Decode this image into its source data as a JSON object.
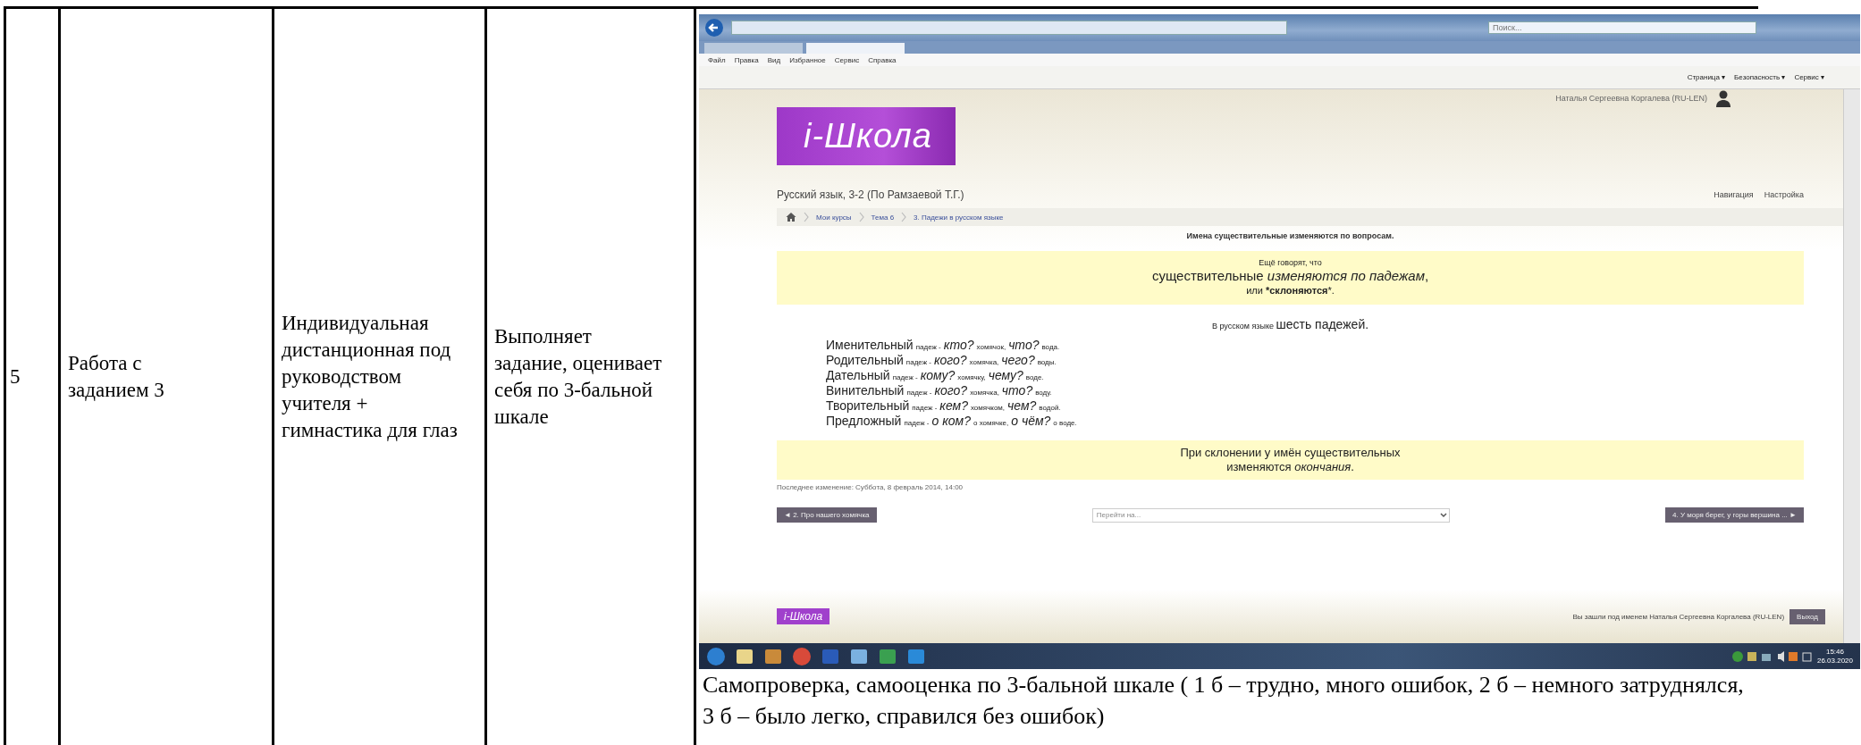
{
  "table_row": {
    "number": "5",
    "stage": "Работа с заданием 3",
    "form": "Индивидуальная дистанционная под руководством учителя + гимнастика для глаз",
    "student_activity": "Выполняет задание, оценивает себя по 3-бальной шкале"
  },
  "screenshot": {
    "browser": {
      "search_placeholder": "Поиск...",
      "menu": [
        "Файл",
        "Правка",
        "Вид",
        "Избранное",
        "Сервис",
        "Справка"
      ],
      "command_bar": [
        "Страница ▾",
        "Безопасность ▾",
        "Сервис ▾"
      ]
    },
    "site": {
      "logo": "i-Школа",
      "user": "Наталья Сергеевна Коргалева (RU-LEN)",
      "course_title": "Русский язык, 3-2 (По Рамзаевой Т.Г.)",
      "header_links": [
        "Навигация",
        "Настройка"
      ],
      "breadcrumbs": [
        "Мои курсы",
        "Тема 6",
        "3. Падежи в русском языке"
      ],
      "intro": "Имена существительные изменяются по вопросам.",
      "note_1": [
        "Ещё говорят, что",
        "существительные *изменяются по падежам*,",
        "или ***склоняются***."
      ],
      "cases_lead": "В русском языке",
      "cases_main": "шесть падежей.",
      "cases": [
        {
          "name": "Именительный",
          "word": "падеж -",
          "q1": "кто?",
          "a1": "хомячок,",
          "q2": "что?",
          "a2": "вода."
        },
        {
          "name": "Родительный",
          "word": "падеж -",
          "q1": "кого?",
          "a1": "хомячка,",
          "q2": "чего?",
          "a2": "воды."
        },
        {
          "name": "Дательный",
          "word": "падеж -",
          "q1": "кому?",
          "a1": "хомячку,",
          "q2": "чему?",
          "a2": "воде."
        },
        {
          "name": "Винительный",
          "word": "падеж -",
          "q1": "кого?",
          "a1": "хомячка,",
          "q2": "что?",
          "a2": "воду."
        },
        {
          "name": "Творительный",
          "word": "падеж -",
          "q1": "кем?",
          "a1": "хомячком,",
          "q2": "чем?",
          "a2": "водой."
        },
        {
          "name": "Предложный",
          "word": "падеж -",
          "q1": "о ком?",
          "a1": "о хомячке,",
          "q2": "о чём?",
          "a2": "о воде."
        }
      ],
      "note_2": [
        "При склонении у имён существительных",
        "изменяются *окончания*."
      ],
      "last_modified": "Последнее изменение: Суббота, 8 февраль 2014, 14:00",
      "prev_button": "◄ 2. Про нашего хомячка",
      "jump_placeholder": "Перейти на...",
      "next_button": "4. У моря берег, у горы вершина ... ►",
      "footer_logo": "i-Школа",
      "footer_text": "Вы зашли под именем Наталья Сергеевна Коргалева (RU-LEN)",
      "logout_button": "Выход"
    },
    "taskbar": {
      "time": "15:46",
      "date": "26.03.2020"
    }
  },
  "caption": "Самопроверка, самооценка по 3-бальной шкале ( 1 б – трудно, много ошибок, 2 б – немного затруднялся, 3 б – было легко, справился без ошибок)"
}
